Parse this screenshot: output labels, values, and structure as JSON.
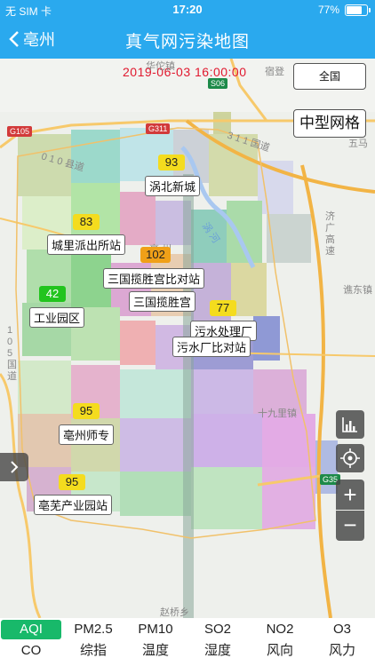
{
  "status": {
    "carrier": "无 SIM 卡",
    "time": "17:20",
    "battery": "77%",
    "battery_level": 0.77
  },
  "nav": {
    "back_label": "亳州",
    "title": "真气网污染地图"
  },
  "map": {
    "datetime": "2019-06-03 16:00:00",
    "scope_button": "全国",
    "grid_button": "中型网格",
    "places": {
      "huatuo": "华佗镇",
      "sudeng": "宿登",
      "road311": "3 1 1 国道",
      "wuma": "五马",
      "county010": "0 1 0 县道",
      "jifu": "济 广 高 速",
      "qiaodong": "谯东镇",
      "guo105": "1 0 5 国 道",
      "shijiuli": "十九里镇",
      "zhaoqiao": "赵桥乡",
      "guohe": "涡 河",
      "bozhou": "亳 州"
    },
    "road_shields": {
      "g105": "G105",
      "g311": "G311",
      "s06": "S06",
      "g35": "G35"
    },
    "stations": [
      {
        "aqi": "93",
        "name": "涡北新城",
        "color": "#f4dc1e"
      },
      {
        "aqi": "83",
        "name": "城里派出所站",
        "color": "#f4dc1e"
      },
      {
        "aqi": "102",
        "name": "三国揽胜宫比对站",
        "color": "#f0a018"
      },
      {
        "aqi": "42",
        "name": "工业园区",
        "color": "#22c41e"
      },
      {
        "aqi": "",
        "name": "三国揽胜宫",
        "color": "#f0a018"
      },
      {
        "aqi": "77",
        "name": "污水处理厂",
        "color": "#f4dc1e"
      },
      {
        "aqi": "",
        "name": "污水厂比对站",
        "color": "#f4dc1e"
      },
      {
        "aqi": "95",
        "name": "亳州师专",
        "color": "#f4dc1e"
      },
      {
        "aqi": "95",
        "name": "亳芜产业园站",
        "color": "#f4dc1e"
      }
    ],
    "controls": {
      "zoom_in": "+",
      "zoom_out": "−"
    }
  },
  "tabs": [
    {
      "top": "AQI",
      "bottom": "CO",
      "active": true
    },
    {
      "top": "PM2.5",
      "bottom": "综指"
    },
    {
      "top": "PM10",
      "bottom": "温度"
    },
    {
      "top": "SO2",
      "bottom": "湿度"
    },
    {
      "top": "NO2",
      "bottom": "风向"
    },
    {
      "top": "O3",
      "bottom": "风力"
    }
  ],
  "colors": {
    "brand": "#2aa9ee",
    "active_tab": "#18b96a",
    "datetime": "#e0182e"
  }
}
